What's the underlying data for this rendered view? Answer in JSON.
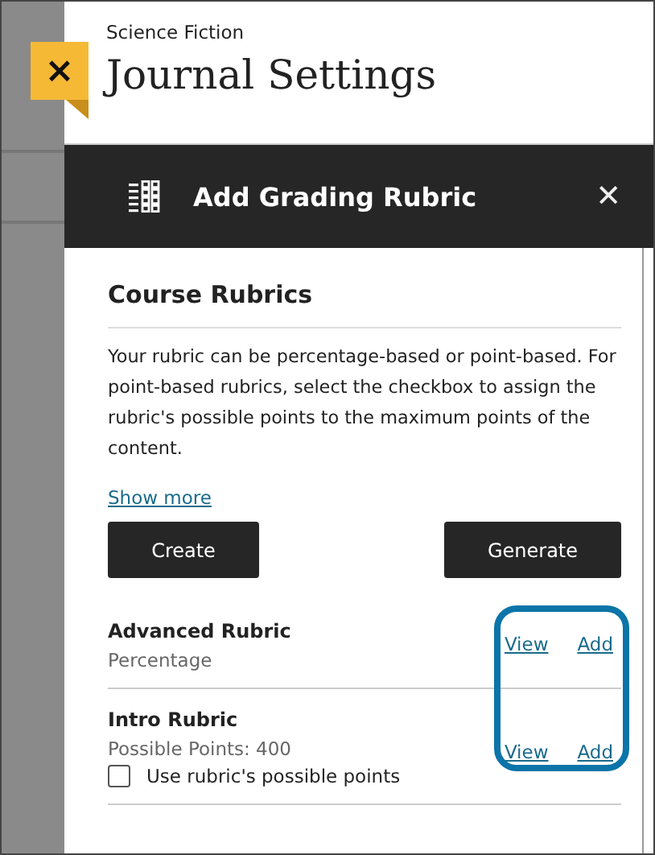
{
  "header": {
    "course": "Science Fiction",
    "title": "Journal Settings",
    "close_tab": "×"
  },
  "panel": {
    "title": "Add Grading Rubric",
    "close": "✕"
  },
  "section": {
    "title": "Course Rubrics",
    "description": "Your rubric can be percentage-based or point-based. For point-based rubrics, select the checkbox to assign the rubric's possible points to the maximum points of the content.",
    "show_more": "Show more",
    "buttons": [
      "Create",
      "Generate"
    ]
  },
  "rubrics": [
    {
      "name": "Advanced Rubric",
      "detail": "Percentage",
      "view": "View",
      "add": "Add"
    },
    {
      "name": "Intro Rubric",
      "detail": "Possible Points: 400",
      "view": "View",
      "add": "Add",
      "checkbox": {
        "label": "Use rubric's possible points",
        "checked": false
      }
    }
  ]
}
